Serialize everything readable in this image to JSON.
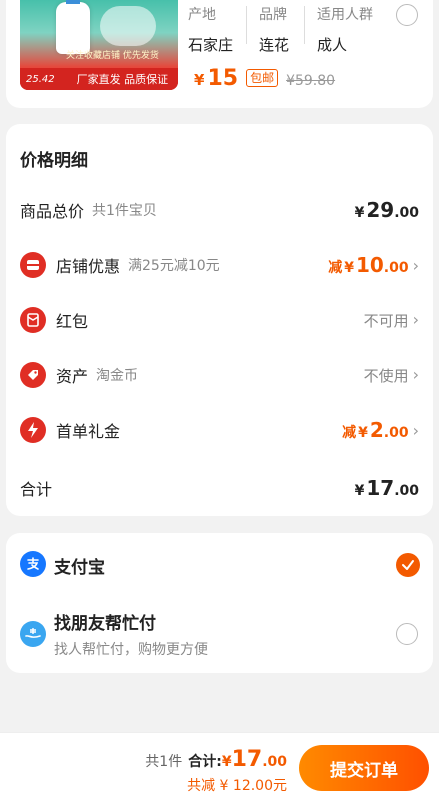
{
  "product": {
    "image_price": "25.42",
    "image_slogan": "厂家直发 品质保证",
    "image_tagline": "关注收藏店铺 优先发货",
    "attributes": [
      {
        "label": "产地",
        "value": "石家庄"
      },
      {
        "label": "品牌",
        "value": "连花"
      },
      {
        "label": "适用人群",
        "value": "成人"
      }
    ],
    "price_symbol": "¥",
    "price": "15",
    "shipping_badge": "包邮",
    "original_price": "¥59.80"
  },
  "price_detail": {
    "title": "价格明细",
    "rows": [
      {
        "label": "商品总价",
        "sub": "共1件宝贝",
        "currency": "¥",
        "int": "29",
        "dec": ".00"
      },
      {
        "label": "店铺优惠",
        "sub": "满25元减10元",
        "prefix": "减",
        "currency": "¥",
        "int": "10",
        "dec": ".00",
        "icon": "shop-coupon-icon"
      },
      {
        "label": "红包",
        "right_text": "不可用",
        "icon": "red-envelope-icon"
      },
      {
        "label": "资产",
        "sub": "淘金币",
        "right_text": "不使用",
        "icon": "gold-coin-tag-icon"
      },
      {
        "label": "首单礼金",
        "prefix": "减",
        "currency": "¥",
        "int": "2",
        "dec": ".00",
        "icon": "lightning-icon"
      },
      {
        "label": "合计",
        "currency": "¥",
        "int": "17",
        "dec": ".00"
      }
    ]
  },
  "payment": {
    "alipay": {
      "label": "支付宝",
      "selected": true
    },
    "friend_pay": {
      "label": "找朋友帮忙付",
      "sub": "找人帮忙付，购物更方便",
      "selected": false
    }
  },
  "footer": {
    "count_text": "共1件",
    "total_label": "合计:",
    "currency": "¥",
    "total_int": "17",
    "total_dec": ".00",
    "discount_text": "共减 ¥ 12.00元",
    "submit_label": "提交订单"
  },
  "colors": {
    "accent": "#f35a00",
    "icon_red": "#e02e24",
    "alipay_blue": "#1677ff"
  }
}
